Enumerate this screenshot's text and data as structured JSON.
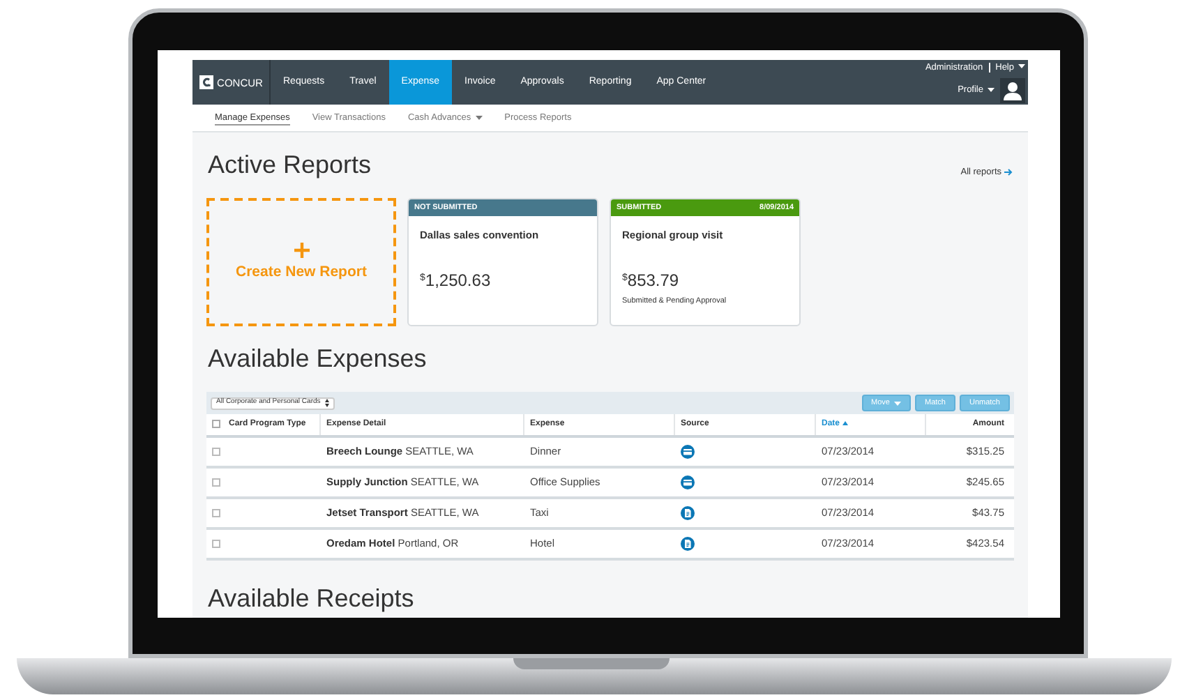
{
  "brand": "CONCUR",
  "nav_tabs": [
    {
      "label": "Requests",
      "selected": false
    },
    {
      "label": "Travel",
      "selected": false
    },
    {
      "label": "Expense",
      "selected": true
    },
    {
      "label": "Invoice",
      "selected": false
    },
    {
      "label": "Approvals",
      "selected": false
    },
    {
      "label": "Reporting",
      "selected": false
    },
    {
      "label": "App Center",
      "selected": false
    }
  ],
  "top_links": [
    {
      "label": "Administration",
      "dropdown": false
    },
    {
      "label": "Help",
      "dropdown": true
    }
  ],
  "profile": {
    "label": "Profile"
  },
  "sub_tabs": [
    {
      "label": "Manage Expenses",
      "selected": true,
      "dropdown": false
    },
    {
      "label": "View Transactions",
      "selected": false,
      "dropdown": false
    },
    {
      "label": "Cash Advances",
      "selected": false,
      "dropdown": true
    },
    {
      "label": "Process Reports",
      "selected": false,
      "dropdown": false
    }
  ],
  "active_reports": {
    "title": "Active Reports",
    "all_link": "All reports",
    "create_label": "Create New Report",
    "reports": [
      {
        "status": "NOT SUBMITTED",
        "color": "#47788c",
        "name": "Dallas sales convention",
        "currency": "$",
        "amount": "1,250.63"
      },
      {
        "status": "SUBMITTED",
        "color": "#4a9a0f",
        "date": "8/09/2014",
        "name": "Regional group visit",
        "currency": "$",
        "amount": "853.79",
        "note": "Submitted & Pending Approval"
      }
    ]
  },
  "available_expenses": {
    "title": "Available Expenses",
    "filter": "All Corporate and Personal Cards",
    "buttons": [
      {
        "label": "Move",
        "dropdown": true
      },
      {
        "label": "Match",
        "dropdown": false
      },
      {
        "label": "Unmatch",
        "dropdown": false
      }
    ],
    "select_all_checked": false,
    "columns": [
      {
        "label": "Card Program Type",
        "sorted": false
      },
      {
        "label": "Expense Detail",
        "sorted": false
      },
      {
        "label": "Expense",
        "sorted": false
      },
      {
        "label": "Source",
        "sorted": false
      },
      {
        "label": "Date",
        "sorted": true
      },
      {
        "label": "Amount",
        "sorted": false
      }
    ],
    "rows": [
      {
        "checked": false,
        "merchant": "Breech Lounge",
        "location": "SEATTLE, WA",
        "expense": "Dinner",
        "kind": "card",
        "date": "07/23/2014",
        "amount": "$315.25"
      },
      {
        "checked": false,
        "merchant": "Supply Junction",
        "location": "SEATTLE, WA",
        "expense": "Office Supplies",
        "kind": "card",
        "date": "07/23/2014",
        "amount": "$245.65"
      },
      {
        "checked": false,
        "merchant": "Jetset Transport",
        "location": "SEATTLE, WA",
        "expense": "Taxi",
        "kind": "receipt",
        "date": "07/23/2014",
        "amount": "$43.75"
      },
      {
        "checked": false,
        "merchant": "Oredam Hotel",
        "location": "Portland, OR",
        "expense": "Hotel",
        "kind": "receipt",
        "date": "07/23/2014",
        "amount": "$423.54"
      }
    ]
  },
  "available_receipts": {
    "title": "Available Receipts"
  }
}
